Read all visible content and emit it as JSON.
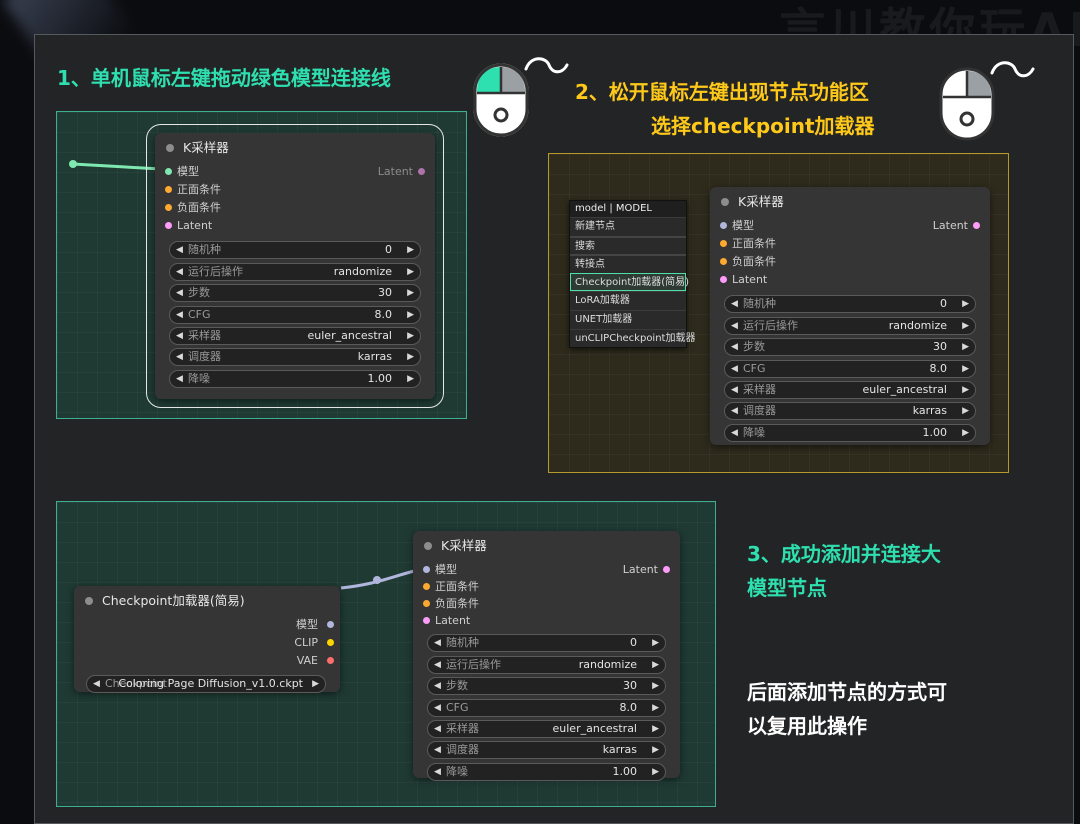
{
  "watermark": "言川教你玩AI",
  "steps": {
    "step1": "1、单机鼠标左键拖动绿色模型连接线",
    "step2_line1": "2、松开鼠标左键出现节点功能区",
    "step2_line2": "选择checkpoint加载器",
    "step3_line1": "3、成功添加并连接大",
    "step3_line2": "模型节点",
    "note_line1": "后面添加节点的方式可",
    "note_line2": "以复用此操作"
  },
  "ksampler": {
    "title": "K采样器",
    "inputs": [
      "模型",
      "正面条件",
      "负面条件",
      "Latent"
    ],
    "output": "Latent",
    "widgets": [
      {
        "label": "随机种",
        "value": "0"
      },
      {
        "label": "运行后操作",
        "value": "randomize"
      },
      {
        "label": "步数",
        "value": "30"
      },
      {
        "label": "CFG",
        "value": "8.0"
      },
      {
        "label": "采样器",
        "value": "euler_ancestral"
      },
      {
        "label": "调度器",
        "value": "karras"
      },
      {
        "label": "降噪",
        "value": "1.00"
      }
    ]
  },
  "context_menu": {
    "header": "model | MODEL",
    "items": [
      "新建节点",
      "搜索",
      "转接点",
      "Checkpoint加载器(简易)",
      "LoRA加载器",
      "UNET加载器",
      "unCLIPCheckpoint加载器"
    ]
  },
  "checkpoint_node": {
    "title": "Checkpoint加载器(简易)",
    "outputs": [
      "模型",
      "CLIP",
      "VAE"
    ],
    "widget_label": "Checkpoint",
    "widget_value": "Coloring Page Diffusion_v1.0.ckpt"
  },
  "colors": {
    "accent_green": "#2ee0b0",
    "accent_yellow": "#ffc91a",
    "model_slot": "#b1b6dd",
    "wire_green": "#7ee8b0",
    "wire_model": "#b1b6dd"
  }
}
